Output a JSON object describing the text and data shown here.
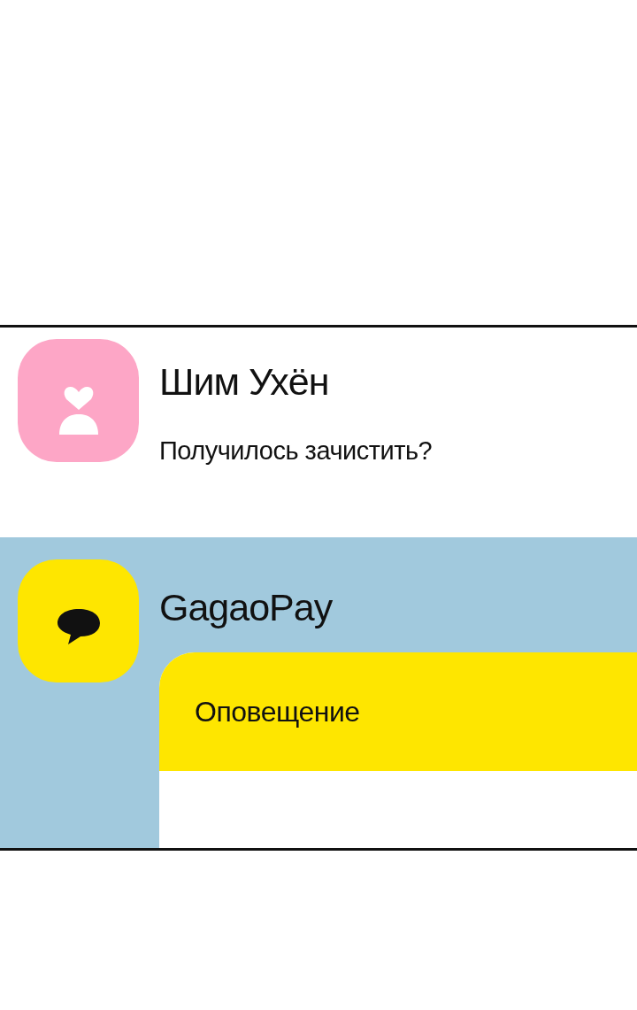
{
  "chats": [
    {
      "kind": "contact",
      "name": "Шим Ухён",
      "message": "Получилось зачистить?"
    },
    {
      "kind": "service",
      "name": "GagaoPay",
      "card": {
        "title": "Оповещение"
      }
    }
  ]
}
